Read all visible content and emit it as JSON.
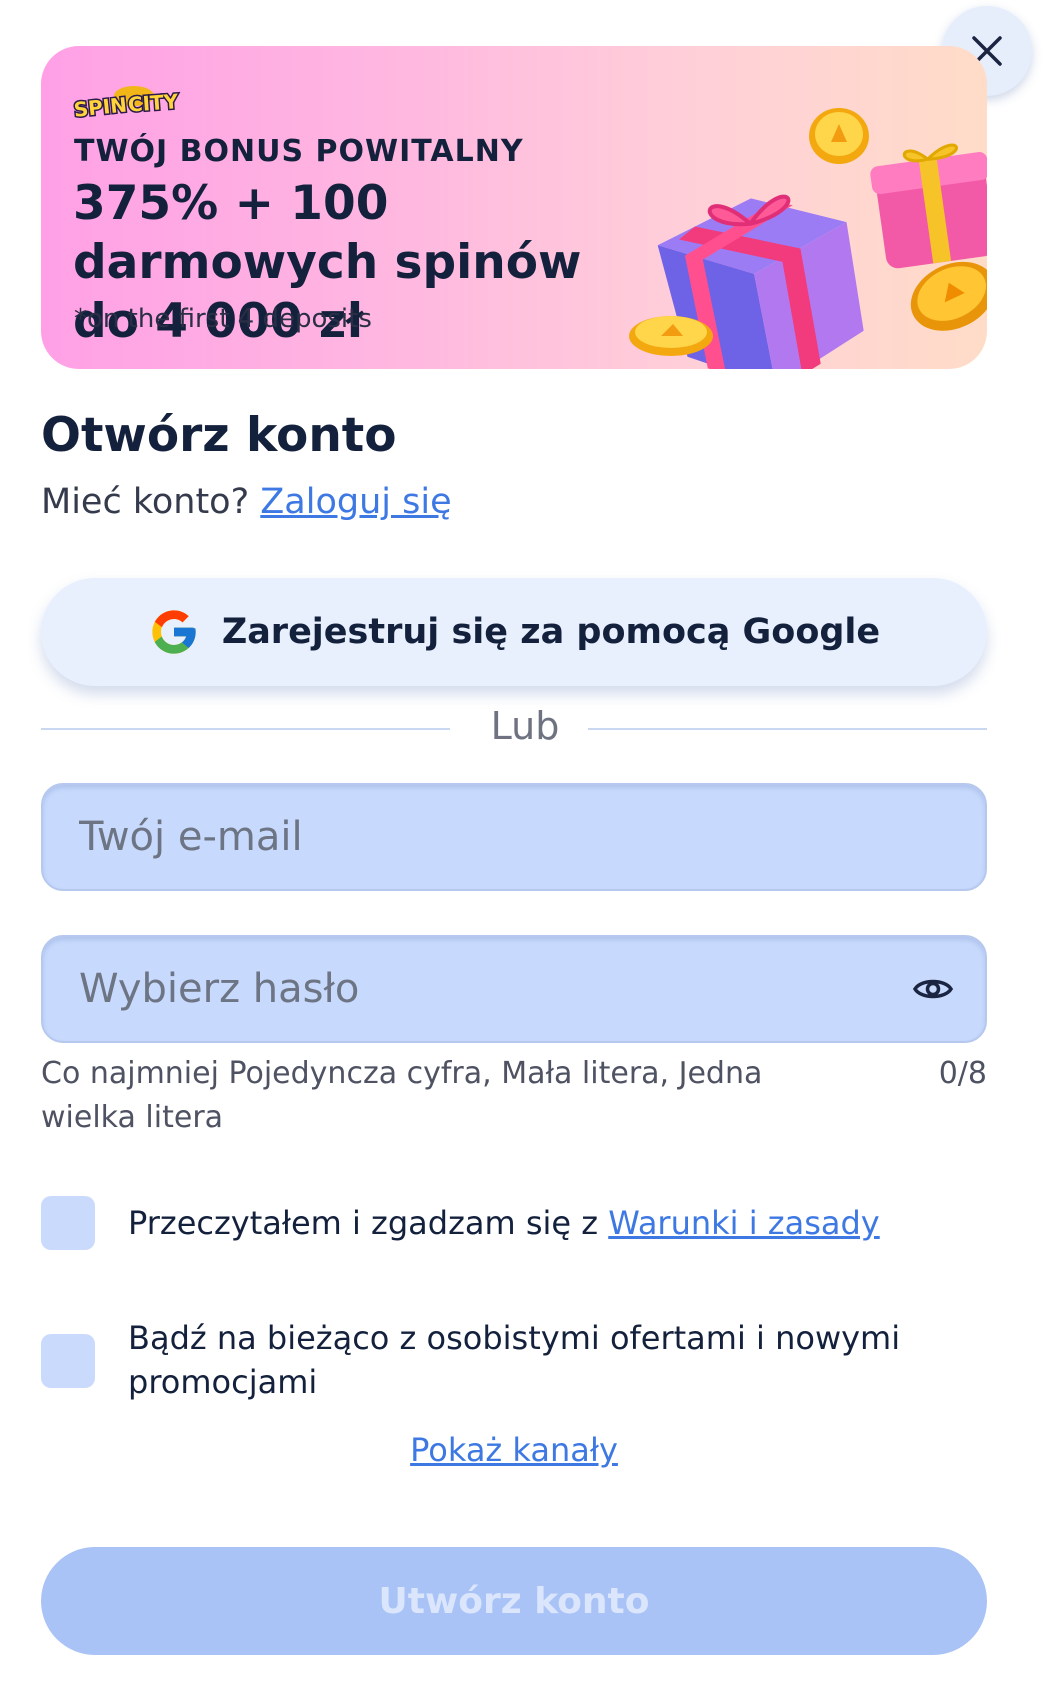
{
  "close": {
    "icon": "close-icon"
  },
  "banner": {
    "logo_text": "SPIN CITY",
    "kicker": "TWÓJ BONUS POWITALNY",
    "headline": "375% + 100 darmowych spinów do 4 000 zł",
    "footnote": "*on the first 4 deposits",
    "illustration": "gift-boxes-and-coins"
  },
  "title": "Otwórz konto",
  "account": {
    "prompt": "Mieć konto?",
    "login_link": "Zaloguj się"
  },
  "google": {
    "icon": "google-logo-icon",
    "label": "Zarejestruj się za pomocą Google"
  },
  "divider": "Lub",
  "email": {
    "placeholder": "Twój e-mail",
    "value": ""
  },
  "password": {
    "placeholder": "Wybierz hasło",
    "value": "",
    "toggle_icon": "eye-icon",
    "hint": "Co najmniej Pojedyncza cyfra, Mała litera, Jedna wielka litera",
    "counter": "0/8"
  },
  "terms": {
    "prefix": "Przeczytałem i zgadzam się z",
    "link": "Warunki i zasady",
    "checked": false
  },
  "promo": {
    "label": "Bądź na bieżąco z osobistymi ofertami i nowymi promocjami",
    "checked": false
  },
  "show_channels": "Pokaż kanały",
  "submit": "Utwórz konto",
  "colors": {
    "accent_link": "#3d78e3",
    "input_bg": "#c7d9fc",
    "button_disabled": "#a9c3f6",
    "text_dark": "#14213d"
  }
}
